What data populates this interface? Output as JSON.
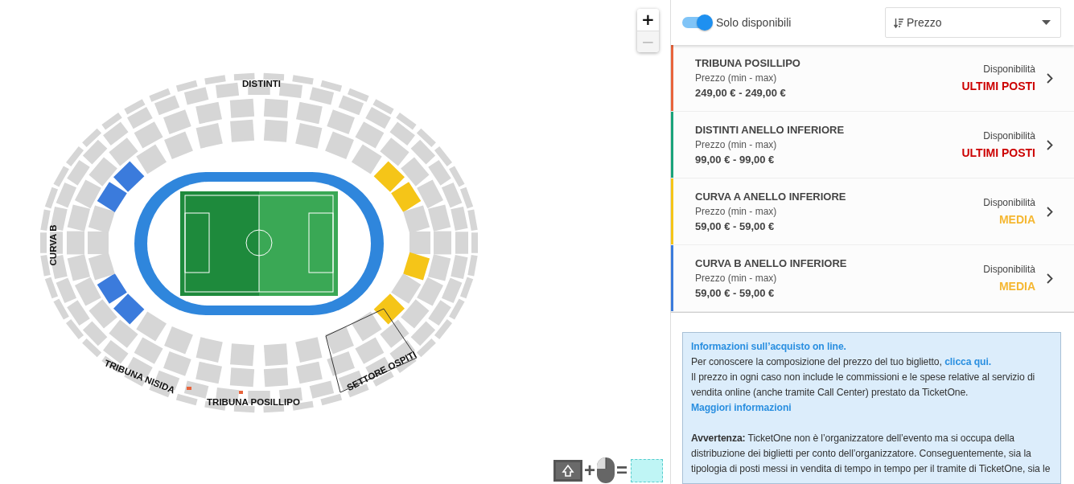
{
  "map": {
    "zoom_buttons": [
      {
        "label": "+",
        "disabled": false
      },
      {
        "label": "−",
        "disabled": true
      }
    ],
    "section_labels": [
      "DISTINTI",
      "CURVA B",
      "TRIBUNA NISIDA",
      "TRIBUNA POSILLIPO",
      "SETTORE OSPITI"
    ],
    "shortcut_legend": {
      "plus": "+",
      "equals": "="
    }
  },
  "filter": {
    "label": "Solo disponibili",
    "on": true
  },
  "sort": {
    "value": "Prezzo"
  },
  "sections": [
    {
      "name": "TRIBUNA POSILLIPO",
      "price_label": "Prezzo (min - max)",
      "price": "249,00 € - 249,00 €",
      "availability_label": "Disponibilità",
      "availability": "ULTIMI POSTI",
      "kind": "low",
      "color": "#e8643c"
    },
    {
      "name": "DISTINTI ANELLO INFERIORE",
      "price_label": "Prezzo (min - max)",
      "price": "99,00 € - 99,00 €",
      "availability_label": "Disponibilità",
      "availability": "ULTIMI POSTI",
      "kind": "low",
      "color": "#1aa37a"
    },
    {
      "name": "CURVA A ANELLO INFERIORE",
      "price_label": "Prezzo (min - max)",
      "price": "59,00 € - 59,00 €",
      "availability_label": "Disponibilità",
      "availability": "MEDIA",
      "kind": "medium",
      "color": "#f5c518"
    },
    {
      "name": "CURVA B ANELLO INFERIORE",
      "price_label": "Prezzo (min - max)",
      "price": "59,00 € - 59,00 €",
      "availability_label": "Disponibilità",
      "availability": "MEDIA",
      "kind": "medium",
      "color": "#3b7bdc"
    }
  ],
  "info": {
    "title": "Informazioni sull’acquisto on line.",
    "price_text": "Per conoscere la composizione del prezzo del tuo biglietto,",
    "price_link": "clicca qui.",
    "fee_text": "Il prezzo in ogni caso non include le commissioni e le spese relative al servizio di vendita online (anche tramite Call Center) prestato da TicketOne.",
    "fee_link": "Maggiori informazioni",
    "warning": "**Avvertenza:** TicketOne non è l’organizzatore dell’evento ma si occupa della distribuzione dei biglietti per conto dell’organizzatore. Conseguentemente, sia la tipologia di posti messi in vendita di tempo in tempo per il tramite di TicketOne, sia le"
  }
}
